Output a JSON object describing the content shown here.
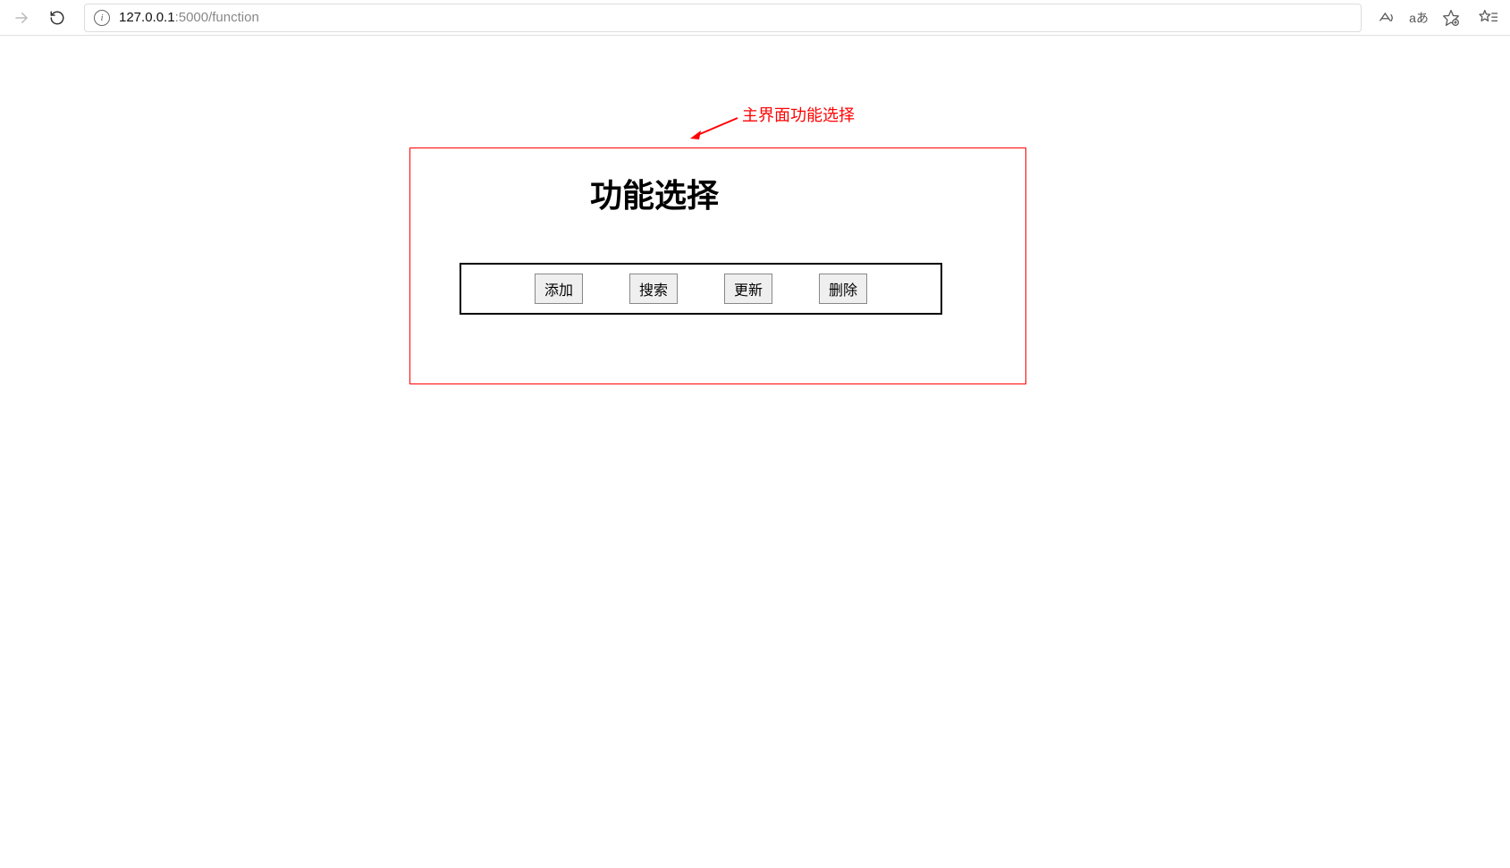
{
  "browser": {
    "url_host": "127.0.0.1",
    "url_port_path": ":5000/function"
  },
  "annotation": {
    "label": "主界面功能选择"
  },
  "page": {
    "title": "功能选择",
    "buttons": {
      "add": "添加",
      "search": "搜索",
      "update": "更新",
      "delete": "删除"
    }
  }
}
